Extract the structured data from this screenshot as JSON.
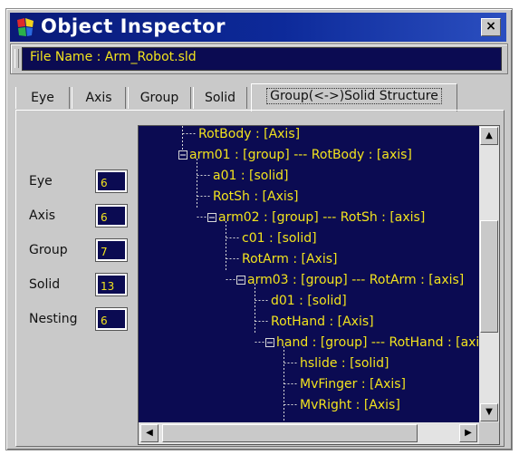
{
  "window": {
    "title": "Object Inspector",
    "close_label": "×"
  },
  "file": {
    "text": "File Name : Arm_Robot.sld"
  },
  "tabs": [
    {
      "label": "Eye"
    },
    {
      "label": "Axis"
    },
    {
      "label": "Group"
    },
    {
      "label": "Solid"
    },
    {
      "label": "Group(<->)Solid Structure"
    }
  ],
  "stats": [
    {
      "label": "Eye",
      "value": "6"
    },
    {
      "label": "Axis",
      "value": "6"
    },
    {
      "label": "Group",
      "value": "7"
    },
    {
      "label": "Solid",
      "value": "13"
    },
    {
      "label": "Nesting",
      "value": "6"
    }
  ],
  "tree": [
    {
      "text": "RotBody : [Axis]"
    },
    {
      "text": "arm01 : [group] --- RotBody : [axis]"
    },
    {
      "text": "a01 : [solid]"
    },
    {
      "text": "RotSh : [Axis]"
    },
    {
      "text": "arm02 : [group] --- RotSh : [axis]"
    },
    {
      "text": "c01 : [solid]"
    },
    {
      "text": "RotArm : [Axis]"
    },
    {
      "text": "arm03 : [group] --- RotArm : [axis]"
    },
    {
      "text": "d01 : [solid]"
    },
    {
      "text": "RotHand : [Axis]"
    },
    {
      "text": "hand : [group] --- RotHand : [axis]"
    },
    {
      "text": "hslide : [solid]"
    },
    {
      "text": "MvFinger : [Axis]"
    },
    {
      "text": "MvRight : [Axis]"
    }
  ],
  "colors": {
    "title_bar": "#0d2a9a",
    "field_background": "#0b0b52",
    "field_text": "#f2e31e",
    "window_face": "#c9c9c9"
  },
  "icons": {
    "app": "multicolor-cube-icon",
    "close": "close-icon",
    "scroll_up": "arrow-up-icon",
    "scroll_down": "arrow-down-icon",
    "scroll_left": "arrow-left-icon",
    "scroll_right": "arrow-right-icon",
    "expand": "minus-box-icon"
  }
}
